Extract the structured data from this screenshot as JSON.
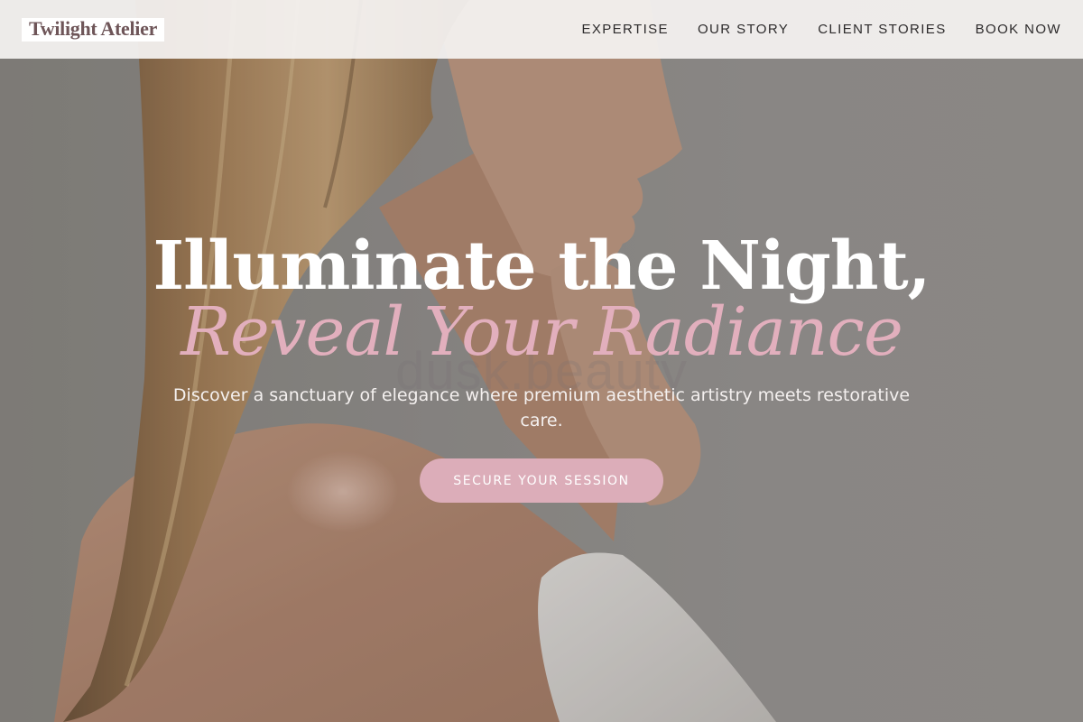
{
  "brand": {
    "name": "Twilight Atelier"
  },
  "nav": {
    "items": [
      {
        "label": "EXPERTISE"
      },
      {
        "label": "OUR STORY"
      },
      {
        "label": "CLIENT STORIES"
      },
      {
        "label": "BOOK NOW"
      }
    ]
  },
  "hero": {
    "headline_line1": "Illuminate the Night,",
    "headline_line2": "Reveal Your Radiance",
    "watermark": "dusk.beauty",
    "subtitle": "Discover a sanctuary of elegance where premium aesthetic artistry meets restorative care.",
    "cta_label": "SECURE YOUR SESSION",
    "image_subject": "woman-profile-portrait"
  },
  "colors": {
    "accent_pink": "#dcadb9",
    "headline_pink": "#e2afbd",
    "logo_text": "#6e5558",
    "nav_text": "#2c2a2b"
  }
}
